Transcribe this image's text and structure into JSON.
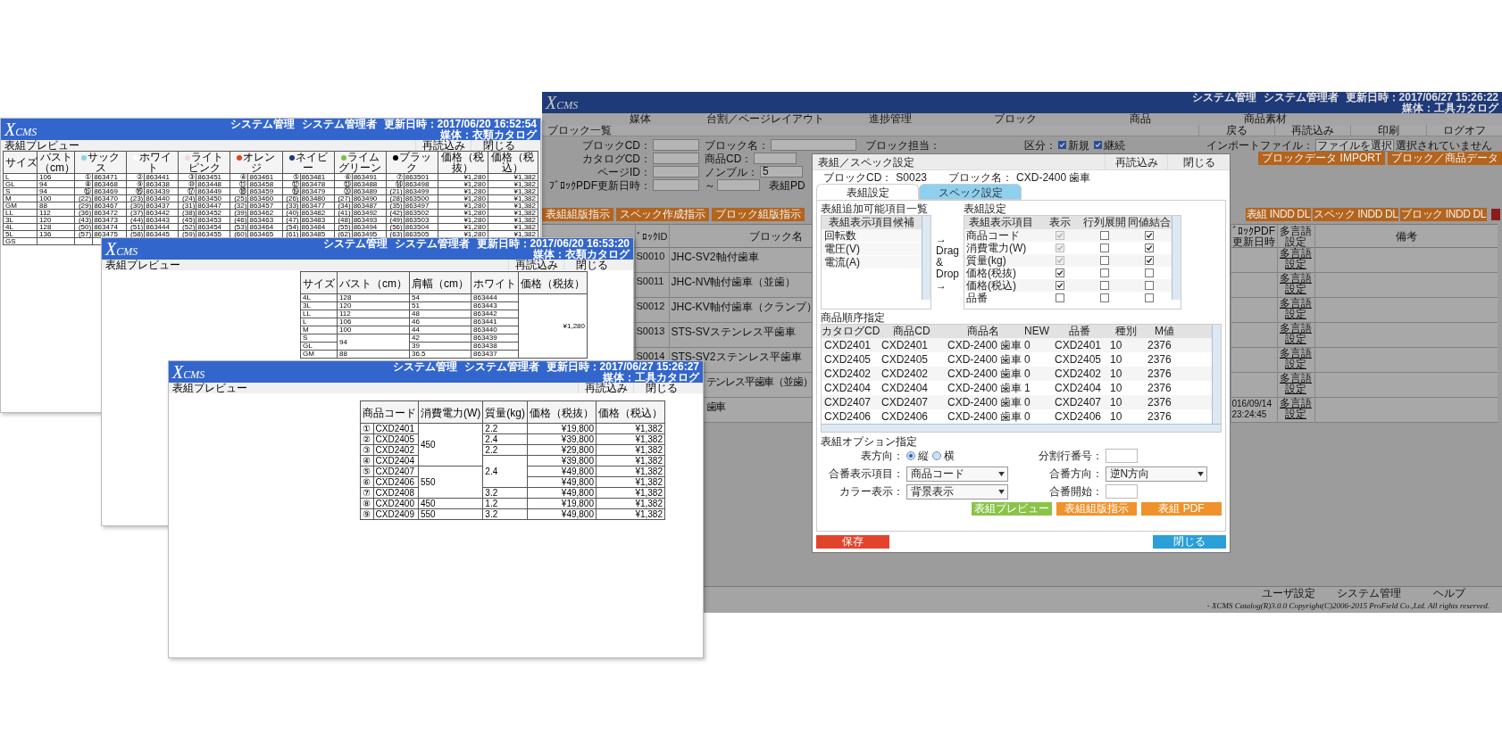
{
  "previews": [
    {
      "logo": "XCMS",
      "header_items": [
        "システム管理",
        "システム管理者",
        "更新日時：2017/06/20 16:52:54"
      ],
      "catalog": "媒体：衣類カタログ",
      "title": "表組プレビュー",
      "buttons": [
        "再読込み",
        "閉じる"
      ],
      "table": {
        "kind": "color_grid",
        "columns": [
          {
            "label": "サイズ",
            "kind": "text"
          },
          {
            "label": "バスト（cm）",
            "kind": "text"
          },
          {
            "label": "サックス",
            "kind": "color",
            "color": "#8fd0ee"
          },
          {
            "label": "ホワイト",
            "kind": "color",
            "color": "#ffffff"
          },
          {
            "label": "ライトピンク",
            "kind": "color",
            "color": "#f6d6d6"
          },
          {
            "label": "オレンジ",
            "kind": "color",
            "color": "#e8401c"
          },
          {
            "label": "ネイビー",
            "kind": "color",
            "color": "#1c3a78"
          },
          {
            "label": "ライムグリーン",
            "kind": "color",
            "color": "#7ac143"
          },
          {
            "label": "ブラック",
            "kind": "color",
            "color": "#000000"
          },
          {
            "label": "価格（税抜）",
            "kind": "price"
          },
          {
            "label": "価格（税込）",
            "kind": "price"
          }
        ],
        "rows": [
          {
            "size": "L",
            "bust": "106",
            "codes": [
              [
                "①",
                "863471"
              ],
              [
                "②",
                "863441"
              ],
              [
                "③",
                "863451"
              ],
              [
                "④",
                "863461"
              ],
              [
                "⑤",
                "863481"
              ],
              [
                "⑥",
                "863491"
              ],
              [
                "⑦",
                "863501"
              ]
            ],
            "prices": [
              "¥1,280",
              "¥1,382"
            ]
          },
          {
            "size": "GL",
            "bust": "94",
            "codes": [
              [
                "⑧",
                "863468"
              ],
              [
                "⑨",
                "863438"
              ],
              [
                "⑩",
                "863448"
              ],
              [
                "⑪",
                "863458"
              ],
              [
                "⑫",
                "863478"
              ],
              [
                "⑬",
                "863488"
              ],
              [
                "⑭",
                "863498"
              ]
            ],
            "prices": [
              "¥1,280",
              "¥1,382"
            ]
          },
          {
            "size": "S",
            "bust": "94",
            "codes": [
              [
                "⑮",
                "863469"
              ],
              [
                "⑯",
                "863439"
              ],
              [
                "⑰",
                "863449"
              ],
              [
                "⑱",
                "863459"
              ],
              [
                "⑲",
                "863479"
              ],
              [
                "⑳",
                "863489"
              ],
              [
                "(21)",
                "863499"
              ]
            ],
            "prices": [
              "¥1,280",
              "¥1,382"
            ]
          },
          {
            "size": "M",
            "bust": "100",
            "codes": [
              [
                "(22)",
                "863470"
              ],
              [
                "(23)",
                "863440"
              ],
              [
                "(24)",
                "863450"
              ],
              [
                "(25)",
                "863460"
              ],
              [
                "(26)",
                "863480"
              ],
              [
                "(27)",
                "863490"
              ],
              [
                "(28)",
                "863500"
              ]
            ],
            "prices": [
              "¥1,280",
              "¥1,382"
            ]
          },
          {
            "size": "GM",
            "bust": "88",
            "codes": [
              [
                "(29)",
                "863467"
              ],
              [
                "(30)",
                "863437"
              ],
              [
                "(31)",
                "863447"
              ],
              [
                "(32)",
                "863457"
              ],
              [
                "(33)",
                "863477"
              ],
              [
                "(34)",
                "863487"
              ],
              [
                "(35)",
                "863497"
              ]
            ],
            "prices": [
              "¥1,280",
              "¥1,382"
            ]
          },
          {
            "size": "LL",
            "bust": "112",
            "codes": [
              [
                "(36)",
                "863472"
              ],
              [
                "(37)",
                "863442"
              ],
              [
                "(38)",
                "863452"
              ],
              [
                "(39)",
                "863462"
              ],
              [
                "(40)",
                "863482"
              ],
              [
                "(41)",
                "863492"
              ],
              [
                "(42)",
                "863502"
              ]
            ],
            "prices": [
              "¥1,280",
              "¥1,382"
            ]
          },
          {
            "size": "3L",
            "bust": "120",
            "codes": [
              [
                "(43)",
                "863473"
              ],
              [
                "(44)",
                "863443"
              ],
              [
                "(45)",
                "863453"
              ],
              [
                "(46)",
                "863463"
              ],
              [
                "(47)",
                "863483"
              ],
              [
                "(48)",
                "863493"
              ],
              [
                "(49)",
                "863503"
              ]
            ],
            "prices": [
              "¥1,280",
              "¥1,382"
            ]
          },
          {
            "size": "4L",
            "bust": "128",
            "codes": [
              [
                "(50)",
                "863474"
              ],
              [
                "(51)",
                "863444"
              ],
              [
                "(52)",
                "863454"
              ],
              [
                "(53)",
                "863464"
              ],
              [
                "(54)",
                "863484"
              ],
              [
                "(55)",
                "863494"
              ],
              [
                "(56)",
                "863504"
              ]
            ],
            "prices": [
              "¥1,280",
              "¥1,382"
            ]
          },
          {
            "size": "5L",
            "bust": "136",
            "codes": [
              [
                "(57)",
                "863475"
              ],
              [
                "(58)",
                "863445"
              ],
              [
                "(59)",
                "863455"
              ],
              [
                "(60)",
                "863465"
              ],
              [
                "(61)",
                "863485"
              ],
              [
                "(62)",
                "863495"
              ],
              [
                "(63)",
                "863505"
              ]
            ],
            "prices": [
              "¥1,280",
              "¥1,382"
            ]
          },
          {
            "size": "GS"
          }
        ]
      }
    },
    {
      "logo": "XCMS",
      "header_items": [
        "システム管理",
        "システム管理者",
        "更新日時：2017/06/20 16:53:20"
      ],
      "catalog": "媒体：衣類カタログ",
      "title": "表組プレビュー",
      "buttons": [
        "再読込み",
        "閉じる"
      ],
      "table": {
        "kind": "grid",
        "columns": [
          {
            "label": "サイズ",
            "kind": "text"
          },
          {
            "label": "バスト（cm）",
            "kind": "text"
          },
          {
            "label": "肩幅（cm）",
            "kind": "text"
          },
          {
            "label": "ホワイト",
            "kind": "text"
          },
          {
            "label": "価格（税抜）",
            "kind": "price"
          }
        ],
        "rows": [
          [
            "4L",
            "128",
            "54",
            "863444",
            {
              "text": "¥1,280",
              "rowspan": 8
            }
          ],
          [
            "3L",
            "120",
            "51",
            "863443"
          ],
          [
            "LL",
            "112",
            "48",
            "863442"
          ],
          [
            "L",
            "106",
            "46",
            "863441"
          ],
          [
            "M",
            "100",
            "44",
            "863440"
          ],
          [
            "S",
            {
              "text": "94",
              "rowspan": 2
            },
            "42",
            "863439"
          ],
          [
            "GL",
            "39",
            "863438"
          ],
          [
            "GM",
            "88",
            "36.5",
            "863437"
          ]
        ]
      }
    },
    {
      "logo": "XCMS",
      "header_items": [
        "システム管理",
        "システム管理者",
        "更新日時：2017/06/27 15:26:27"
      ],
      "catalog": "媒体：工具カタログ",
      "title": "表組プレビュー",
      "buttons": [
        "再読込み",
        "閉じる"
      ],
      "table": {
        "kind": "numbered",
        "columns": [
          {
            "label": "商品コード",
            "kind": "text",
            "colspan": 2
          },
          {
            "label": "消費電力(W)",
            "kind": "text"
          },
          {
            "label": "質量(kg)",
            "kind": "text"
          },
          {
            "label": "価格（税抜）",
            "kind": "price"
          },
          {
            "label": "価格（税込）",
            "kind": "price"
          }
        ],
        "rows": [
          [
            "①",
            "CXD2401",
            {
              "text": "450",
              "rowspan": 4
            },
            "2.2",
            "¥19,800",
            "¥1,382"
          ],
          [
            "②",
            "CXD2405",
            "2.4",
            "¥39,800",
            "¥1,382"
          ],
          [
            "③",
            "CXD2402",
            "2.2",
            "¥29,800",
            "¥1,382"
          ],
          [
            "④",
            "CXD2404",
            {
              "text": "2.4",
              "rowspan": 3
            },
            "¥39,800",
            "¥1,382"
          ],
          [
            "⑤",
            "CXD2407",
            {
              "text": "550",
              "rowspan": 3
            },
            "¥49,800",
            "¥1,382"
          ],
          [
            "⑥",
            "CXD2406",
            "¥49,800",
            "¥1,382"
          ],
          [
            "⑦",
            "CXD2408",
            "3.2",
            "¥49,800",
            "¥1,382"
          ],
          [
            "⑧",
            "CXD2400",
            "450",
            "1.2",
            "¥19,800",
            "¥1,382"
          ],
          [
            "⑨",
            "CXD2409",
            "550",
            "3.2",
            "¥49,800",
            "¥1,382"
          ]
        ]
      }
    }
  ],
  "main": {
    "logo": "XCMS",
    "header_items": [
      "システム管理",
      "システム管理者",
      "更新日時：2017/06/27 15:26:22"
    ],
    "catalog": "媒体：工具カタログ",
    "menu": [
      "媒体",
      "台割／ページレイアウト",
      "進捗管理",
      "ブロック",
      "商品",
      "商品素材"
    ],
    "page_title": "ブロック一覧",
    "page_buttons": [
      "戻る",
      "再読込み",
      "印刷",
      "ログオフ"
    ],
    "form": [
      [
        {
          "kind": "field",
          "label": "ブロックCD："
        },
        {
          "kind": "field",
          "label": "ブロック名："
        },
        {
          "kind": "label",
          "label": "ブロック担当："
        },
        {
          "kind": "checks",
          "label": "区分：",
          "options": [
            {
              "label": "新規",
              "checked": true
            },
            {
              "label": "継続",
              "checked": true
            }
          ]
        },
        {
          "kind": "file",
          "label": "インポートファイル：",
          "button": "ファイルを選択",
          "note": "選択されていません"
        }
      ],
      [
        {
          "kind": "field",
          "label": "カタログCD："
        },
        {
          "kind": "field",
          "label": "商品CD："
        }
      ],
      [
        {
          "kind": "field",
          "label": "ページID："
        },
        {
          "kind": "field",
          "label": "ノンブル：",
          "value": "5"
        }
      ],
      [
        {
          "kind": "field",
          "label": "ﾌﾞﾛｯｸPDF更新日時："
        },
        {
          "kind": "field",
          "label": "～"
        },
        {
          "kind": "label",
          "label": "表組PD"
        }
      ]
    ],
    "import_buttons": [
      "ブロックデータ IMPORT",
      "ブロック／商品データ"
    ],
    "actions_left": [
      "表組組版指示",
      "スペック作成指示",
      "ブロック組版指示"
    ],
    "actions_right": [
      "表組 INDD DL",
      "スペック INDD DL",
      "ブロック INDD DL"
    ],
    "table": {
      "columns": [
        "ﾞﾛｯｸID",
        "ブロック名",
        "ﾞﾛｯｸPDF 更新日時",
        "多言語設定",
        "備考"
      ],
      "rows": [
        {
          "id": "S0010",
          "name": "JHC-SV2軸付歯車",
          "link": "多言語設定"
        },
        {
          "id": "S0011",
          "name": "JHC-NV軸付歯車（並歯）",
          "link": "多言語設定"
        },
        {
          "id": "S0012",
          "name": "JHC-KV軸付歯車（クランプ）",
          "link": "多言語設定"
        },
        {
          "id": "S0013",
          "name": "STS-SVステンレス平歯車",
          "link": "多言語設定"
        },
        {
          "id": "S0014",
          "name": "STS-SV2ステンレス平歯車",
          "link": "多言語設定"
        },
        {
          "name": "テンレス平歯車（並歯）",
          "link": "多言語設定"
        },
        {
          "name": "歯車",
          "pdf_date": "016/09/14 23:24:45",
          "link": "多言語設定"
        }
      ]
    },
    "footer_links": [
      "ユーザ設定",
      "システム管理",
      "ヘルプ"
    ],
    "copyright": "- XCMS Catalog(R)3.0.0  Copyright(C)2006-2015 ProField Co.,Ltd. All rights reserved."
  },
  "dialog": {
    "title": "表組／スペック設定",
    "buttons": [
      "再読込み",
      "閉じる"
    ],
    "info": [
      {
        "label": "ブロックCD：",
        "value": "S0023"
      },
      {
        "label": "ブロック名：",
        "value": "CXD-2400 歯車"
      }
    ],
    "tabs": [
      {
        "label": "表組設定",
        "selected": true
      },
      {
        "label": "スペック設定",
        "selected": false
      }
    ],
    "candidates": {
      "title": "表組追加可能項目一覧",
      "header": "表組表示項目候補",
      "items": [
        "回転数",
        "電圧(V)",
        "電流(A)"
      ]
    },
    "drag_hint": [
      "→",
      "Drag",
      "&",
      "Drop",
      "→"
    ],
    "layout": {
      "title": "表組設定",
      "columns": [
        "表組表示項目",
        "表示",
        "行列展開",
        "同値結合"
      ],
      "rows": [
        {
          "label": "商品コード",
          "checks": [
            {
              "checked": true,
              "disabled": true
            },
            {
              "checked": false,
              "disabled": false
            },
            {
              "checked": true,
              "disabled": false
            }
          ]
        },
        {
          "label": "消費電力(W)",
          "checks": [
            {
              "checked": true,
              "disabled": true
            },
            {
              "checked": false,
              "disabled": false
            },
            {
              "checked": true,
              "disabled": false
            }
          ]
        },
        {
          "label": "質量(kg)",
          "checks": [
            {
              "checked": true,
              "disabled": true
            },
            {
              "checked": false,
              "disabled": false
            },
            {
              "checked": true,
              "disabled": false
            }
          ]
        },
        {
          "label": "価格(税抜)",
          "checks": [
            {
              "checked": true,
              "disabled": false
            },
            {
              "checked": false,
              "disabled": false
            },
            {
              "checked": false,
              "disabled": false
            }
          ]
        },
        {
          "label": "価格(税込)",
          "checks": [
            {
              "checked": true,
              "disabled": false
            },
            {
              "checked": false,
              "disabled": false
            },
            {
              "checked": false,
              "disabled": false
            }
          ]
        },
        {
          "label": "品番",
          "checks": [
            {
              "checked": false,
              "disabled": false
            },
            {
              "checked": false,
              "disabled": false
            },
            {
              "checked": false,
              "disabled": false
            }
          ]
        }
      ]
    },
    "order": {
      "title": "商品順序指定",
      "columns": [
        "カタログCD",
        "商品CD",
        "商品名",
        "NEW",
        "品番",
        "種別",
        "M値"
      ],
      "rows": [
        [
          "CXD2401",
          "CXD2401",
          "CXD-2400 歯車",
          "0",
          "CXD2401",
          "10",
          "2376"
        ],
        [
          "CXD2405",
          "CXD2405",
          "CXD-2400 歯車",
          "0",
          "CXD2405",
          "10",
          "2376"
        ],
        [
          "CXD2402",
          "CXD2402",
          "CXD-2400 歯車",
          "0",
          "CXD2402",
          "10",
          "2376"
        ],
        [
          "CXD2404",
          "CXD2404",
          "CXD-2400 歯車",
          "1",
          "CXD2404",
          "10",
          "2376"
        ],
        [
          "CXD2407",
          "CXD2407",
          "CXD-2400 歯車",
          "0",
          "CXD2407",
          "10",
          "2376"
        ],
        [
          "CXD2406",
          "CXD2406",
          "CXD-2400 歯車",
          "0",
          "CXD2406",
          "10",
          "2376"
        ]
      ]
    },
    "options": {
      "title": "表組オプション指定",
      "items": [
        {
          "kind": "radio",
          "label": "表方向：",
          "choices": [
            {
              "label": "縦",
              "selected": true
            },
            {
              "label": "横",
              "selected": false
            }
          ]
        },
        {
          "kind": "text",
          "label": "分割行番号："
        },
        {
          "kind": "select",
          "label": "合番表示項目：",
          "value": "商品コード"
        },
        {
          "kind": "select",
          "label": "合番方向：",
          "value": "逆N方向"
        },
        {
          "kind": "select",
          "label": "カラー表示：",
          "value": "背景表示"
        },
        {
          "kind": "text",
          "label": "合番開始："
        }
      ]
    },
    "actions": [
      {
        "label": "表組プレビュー",
        "color": "#8bc34a"
      },
      {
        "label": "表組組版指示",
        "color": "#f0922b"
      },
      {
        "label": "表組 PDF",
        "color": "#f0922b"
      }
    ],
    "footer": [
      {
        "label": "保存",
        "kind": "save"
      },
      {
        "label": "閉じる",
        "kind": "close"
      }
    ]
  }
}
